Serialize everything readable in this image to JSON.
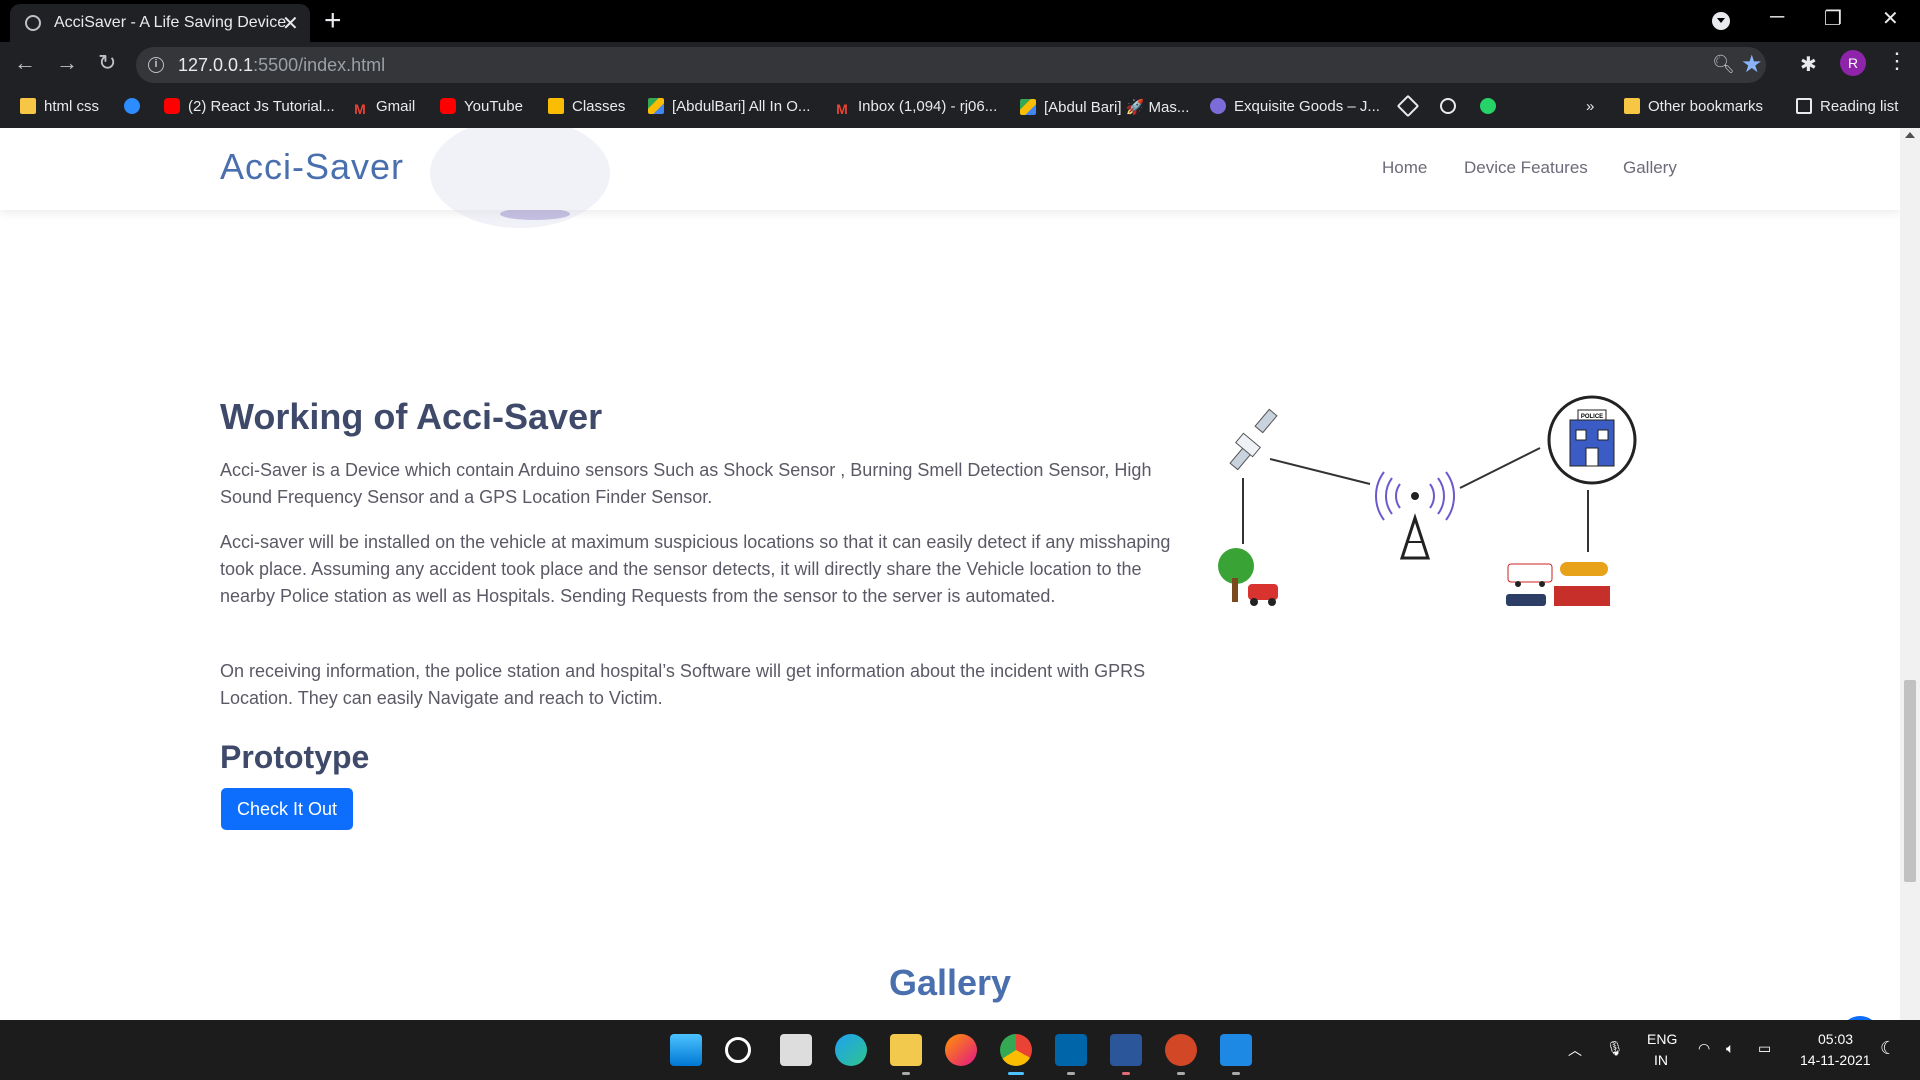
{
  "browser": {
    "tab_title": "AcciSaver - A Life Saving Device",
    "tab_close": "✕",
    "new_tab": "+",
    "url_host": "127.0.0.1",
    "url_path": ":5500/index.html",
    "profile_initial": "R",
    "bookmarks": [
      "html css",
      "(2) React Js Tutorial...",
      "Gmail",
      "YouTube",
      "Classes",
      "[AbdulBari] All In O...",
      "Inbox (1,094) - rj06...",
      "[Abdul Bari] 🚀 Mas...",
      "Exquisite Goods – J..."
    ],
    "bookmarks_overflow": "»",
    "other_bookmarks": "Other bookmarks",
    "reading_list": "Reading list"
  },
  "site": {
    "brand": "Acci-Saver",
    "nav": [
      "Home",
      "Device Features",
      "Gallery"
    ],
    "section_title": "Working of Acci-Saver",
    "paragraphs": [
      "Acci-Saver is a Device which contain Arduino sensors Such as Shock Sensor , Burning Smell Detection Sensor, High Sound Frequency Sensor and a GPS Location Finder Sensor.",
      "Acci-saver will be installed on the vehicle at maximum suspicious locations so that it can easily detect if any misshaping took place. Assuming any accident took place and the sensor detects, it will directly share the Vehicle location to the nearby Police station as well as Hospitals. Sending Requests from the sensor to the server is automated.",
      "On receiving information, the police station and hospital’s Software will get information about the incident with GPRS Location. They can easily Navigate and reach to Victim."
    ],
    "prototype_title": "Prototype",
    "cta_label": "Check It Out",
    "gallery_title": "Gallery",
    "diagram_police_label": "POLICE"
  },
  "taskbar": {
    "lang_top": "ENG",
    "lang_bottom": "IN",
    "time": "05:03",
    "date": "14-11-2021"
  },
  "colors": {
    "brand": "#4a6fae",
    "heading": "#3f4a6a",
    "button": "#0d6efd"
  }
}
